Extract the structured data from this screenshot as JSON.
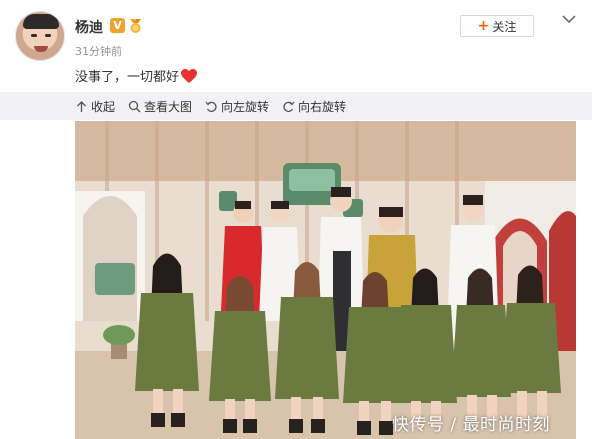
{
  "user": {
    "name": "杨迪",
    "verified_badge": "V",
    "time": "31分钟前"
  },
  "actions": {
    "follow_label": "关注"
  },
  "post": {
    "text": "没事了，一切都好"
  },
  "toolbar": {
    "items": [
      {
        "icon": "collapse-up-icon",
        "label": "收起"
      },
      {
        "icon": "zoom-in-icon",
        "label": "查看大图"
      },
      {
        "icon": "rotate-left-icon",
        "label": "向左旋转"
      },
      {
        "icon": "rotate-right-icon",
        "label": "向右旋转"
      }
    ]
  },
  "photo": {
    "watermark": "快传号 / 最时尚时刻"
  },
  "colors": {
    "accent_orange": "#f55f0a",
    "verified_orange": "#f0a22e",
    "heart_red": "#e8322f",
    "toolbar_bg": "#f2f2f5"
  }
}
